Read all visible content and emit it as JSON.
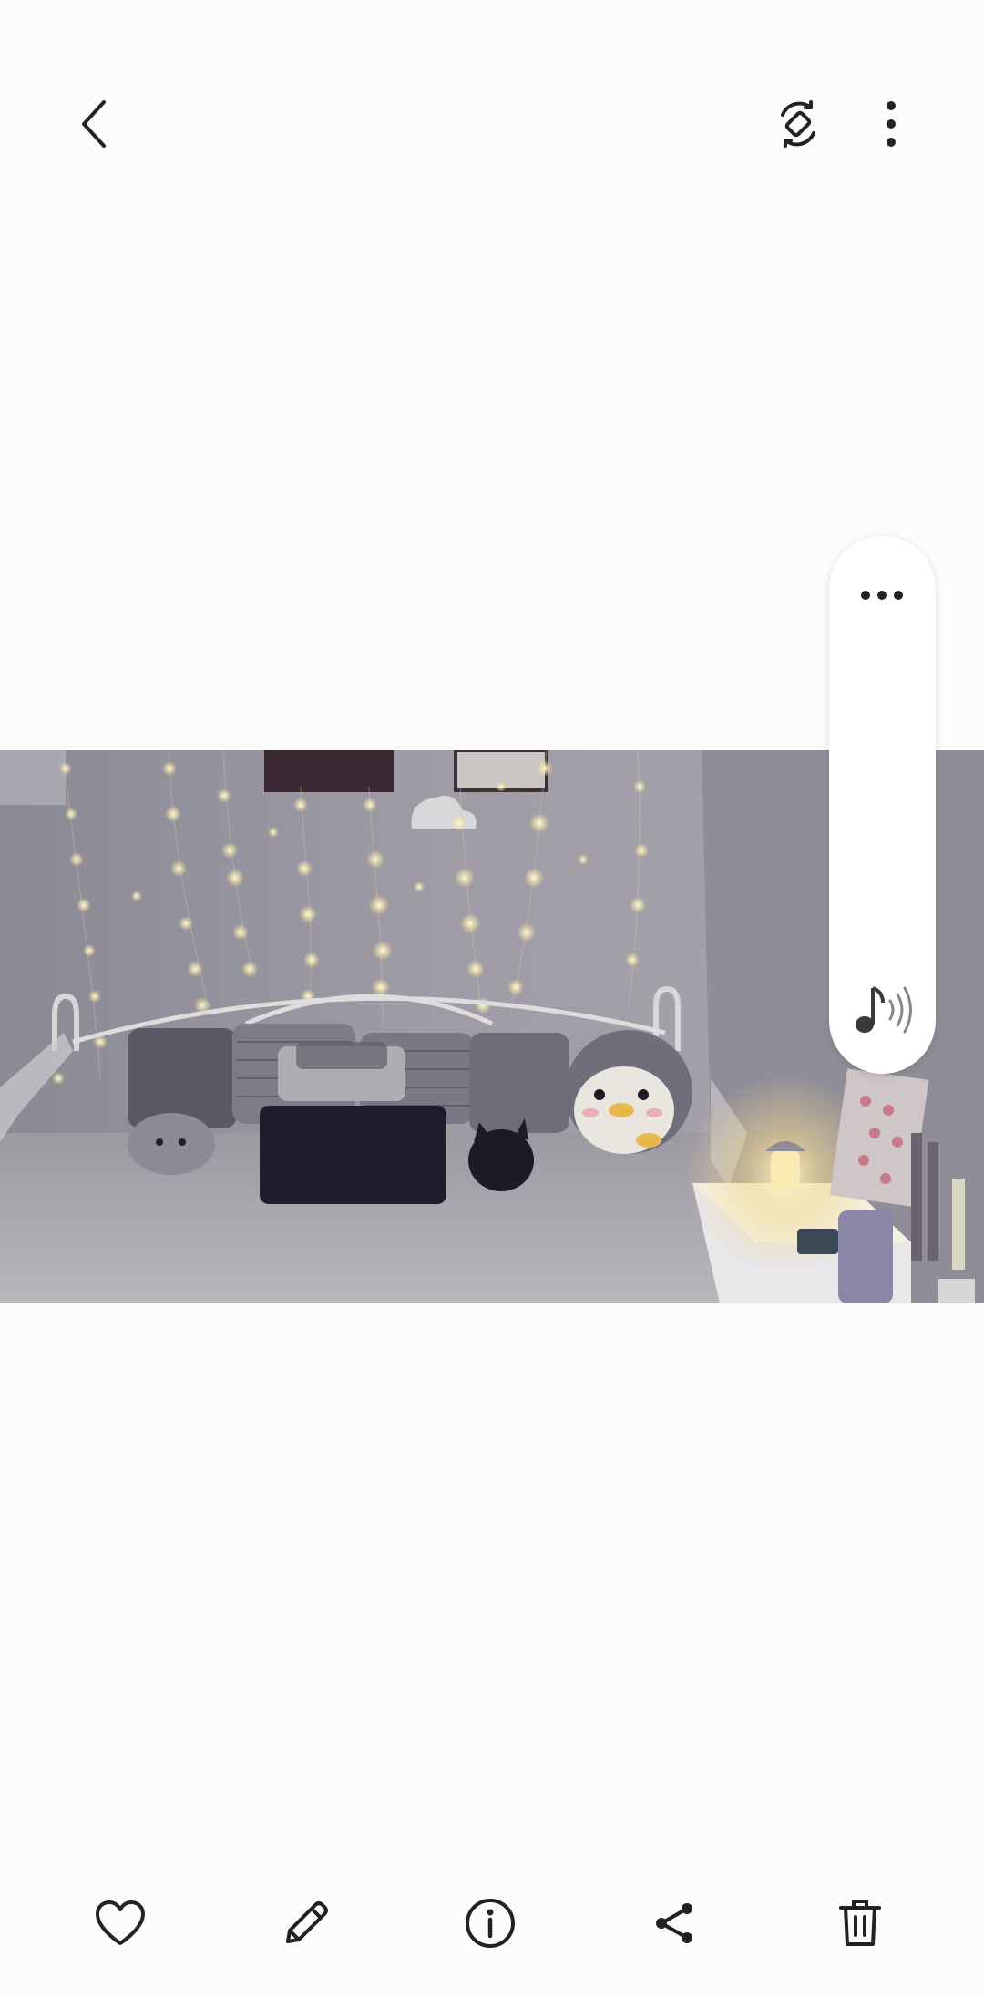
{
  "top_bar": {
    "back_icon": "chevron-left-icon",
    "rotate_icon": "auto-rotate-icon",
    "more_icon": "more-vertical-icon"
  },
  "photo": {
    "subject": "bedroom-photo"
  },
  "sound_panel": {
    "more_icon": "more-horizontal-icon",
    "sound_icon": "sound-shot-icon"
  },
  "bottom_bar": {
    "items": [
      {
        "icon": "heart-icon"
      },
      {
        "icon": "pencil-icon"
      },
      {
        "icon": "info-icon"
      },
      {
        "icon": "share-icon"
      },
      {
        "icon": "trash-icon"
      }
    ]
  },
  "colors": {
    "background": "#fcfcfc",
    "icon": "#222222",
    "panel": "#ffffff"
  }
}
